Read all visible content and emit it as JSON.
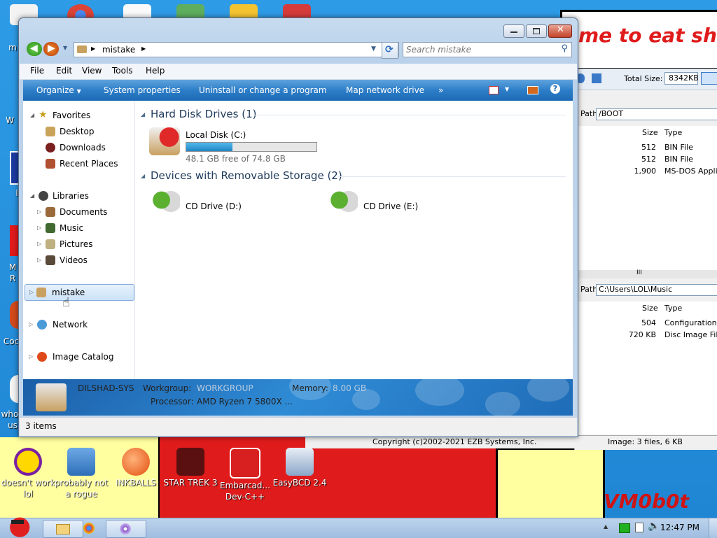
{
  "desktop": {
    "banner_text": "me to eat shit",
    "watermark": "VM0b0t",
    "left_partial_labels": [
      "m",
      "W",
      "I",
      "M",
      "R",
      "Coc",
      "who",
      "us"
    ],
    "icons": [
      {
        "label": "doesn't work lol"
      },
      {
        "label": "probably not a rogue"
      },
      {
        "label": "INKBALLS"
      },
      {
        "label": "STAR TREK 3"
      },
      {
        "label": "Embarcad... Dev-C++"
      },
      {
        "label": "EasyBCD 2.4"
      }
    ]
  },
  "background_app": {
    "total_size_label": "Total Size:",
    "total_size_value": "8342KB",
    "top_path_label": "Path:",
    "top_path_value": "/BOOT",
    "columns": [
      "Size",
      "Type"
    ],
    "top_rows": [
      {
        "size": "512",
        "type": "BIN File"
      },
      {
        "size": "512",
        "type": "BIN File"
      },
      {
        "size": "1,900",
        "type": "MS-DOS Applica"
      }
    ],
    "divider": "III",
    "bottom_path_label": "Path:",
    "bottom_path_value": "C:\\Users\\LOL\\Music",
    "bottom_rows": [
      {
        "size": "504",
        "type": "Configuration Se"
      },
      {
        "size": "720 KB",
        "type": "Disc Image File"
      }
    ],
    "copyright": "Copyright (c)2002-2021 EZB Systems, Inc.",
    "image_info": "Image: 3 files, 6 KB"
  },
  "explorer": {
    "address_location": "mistake",
    "search_placeholder": "Search mistake",
    "menu": [
      "File",
      "Edit",
      "View",
      "Tools",
      "Help"
    ],
    "commands": [
      "Organize",
      "System properties",
      "Uninstall or change a program",
      "Map network drive",
      "»"
    ],
    "nav": {
      "favorites": "Favorites",
      "desktop": "Desktop",
      "downloads": "Downloads",
      "recent": "Recent Places",
      "libraries": "Libraries",
      "documents": "Documents",
      "music": "Music",
      "pictures": "Pictures",
      "videos": "Videos",
      "computer": "mistake",
      "network": "Network",
      "image_catalog": "Image Catalog"
    },
    "groups": {
      "hdd_header": "Hard Disk Drives (1)",
      "removable_header": "Devices with Removable Storage (2)"
    },
    "drives": {
      "local_name": "Local Disk (C:)",
      "local_free": "48.1 GB free of 74.8 GB",
      "local_used_fraction": 0.357,
      "cd_d": "CD Drive (D:)",
      "cd_e": "CD Drive (E:)"
    },
    "details": {
      "computer_name": "DILSHAD-SYS",
      "workgroup_label": "Workgroup:",
      "workgroup_value": "WORKGROUP",
      "memory_label": "Memory:",
      "memory_value": "8.00 GB",
      "processor_label": "Processor:",
      "processor_value": "AMD Ryzen 7 5800X ..."
    },
    "status": "3 items"
  },
  "taskbar": {
    "clock": "12:47 PM"
  },
  "colors": {
    "desktop_blue": "#1f86d4",
    "red_block": "#e01b1b",
    "command_bar": "#2d7ec8",
    "capacity_fill": "#1f86c6"
  }
}
